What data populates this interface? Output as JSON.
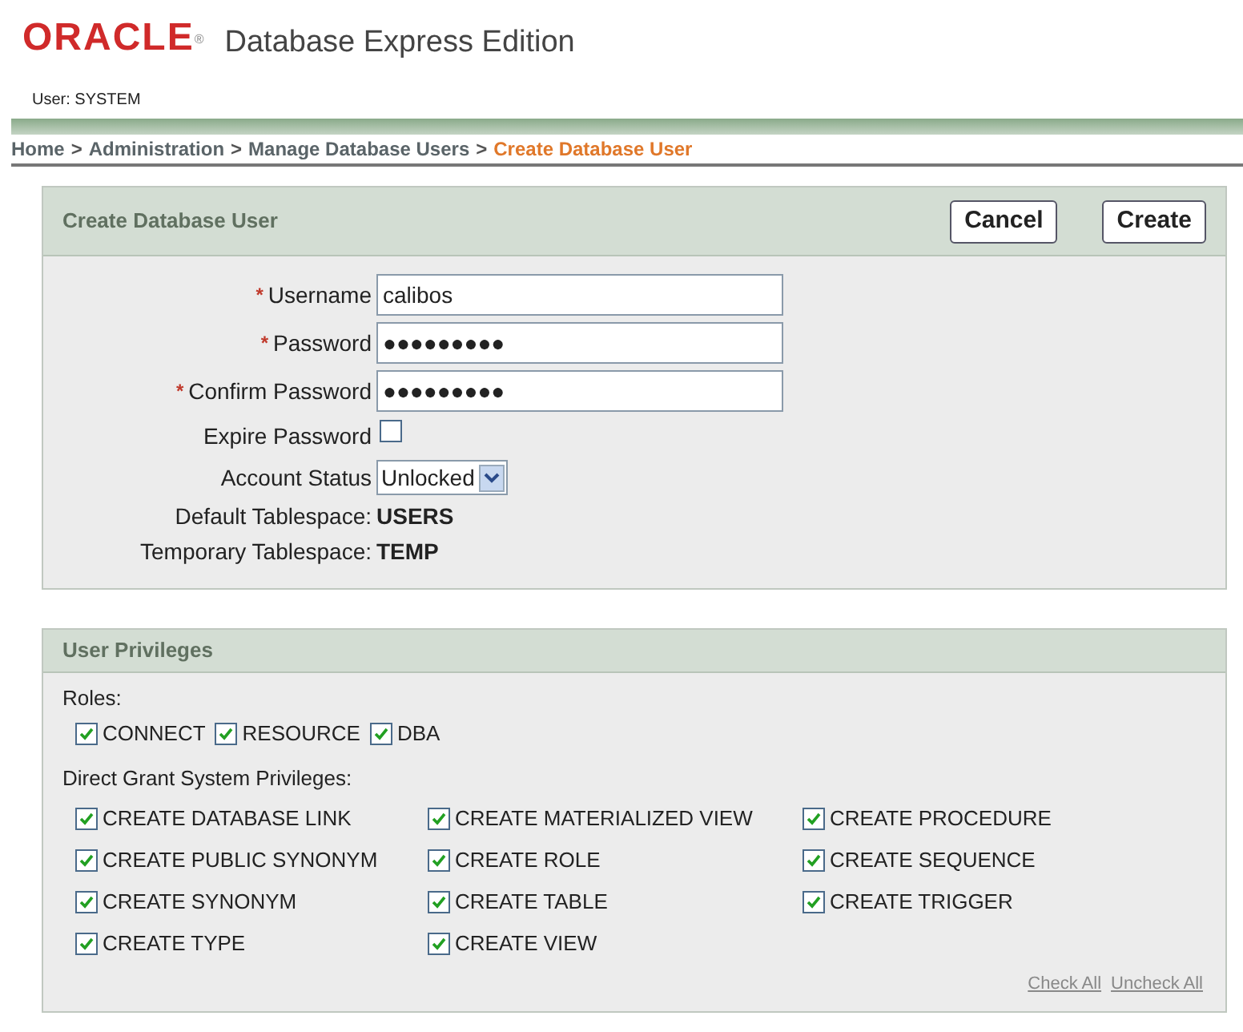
{
  "header": {
    "logo": "ORACLE",
    "logo_mark": "®",
    "product": "Database Express Edition",
    "user": "User: SYSTEM"
  },
  "breadcrumb": [
    {
      "label": "Home",
      "current": false
    },
    {
      "label": "Administration",
      "current": false
    },
    {
      "label": "Manage Database Users",
      "current": false
    },
    {
      "label": "Create Database User",
      "current": true
    }
  ],
  "breadcrumb_separator": ">",
  "create_panel": {
    "title": "Create Database User",
    "buttons": [
      "Cancel",
      "Create"
    ],
    "fields": [
      {
        "kind": "text",
        "label": "Username",
        "required": true,
        "value": "calibos"
      },
      {
        "kind": "text",
        "label": "Password",
        "required": true,
        "value": "●●●●●●●●●"
      },
      {
        "kind": "text",
        "label": "Confirm Password",
        "required": true,
        "value": "●●●●●●●●●"
      },
      {
        "kind": "checkbox",
        "label": "Expire Password",
        "required": false,
        "checked": false
      },
      {
        "kind": "select",
        "label": "Account Status",
        "required": false,
        "value": "Unlocked"
      },
      {
        "kind": "info",
        "label": "Default Tablespace:",
        "required": false,
        "value": "USERS"
      },
      {
        "kind": "info",
        "label": "Temporary Tablespace:",
        "required": false,
        "value": "TEMP"
      }
    ],
    "required_mark": "*"
  },
  "privileges_panel": {
    "title": "User Privileges",
    "roles_label": "Roles:",
    "roles": [
      {
        "label": "CONNECT",
        "checked": true
      },
      {
        "label": "RESOURCE",
        "checked": true
      },
      {
        "label": "DBA",
        "checked": true
      }
    ],
    "system_label": "Direct Grant System Privileges:",
    "system_privileges": [
      {
        "label": "CREATE DATABASE LINK",
        "checked": true
      },
      {
        "label": "CREATE MATERIALIZED VIEW",
        "checked": true
      },
      {
        "label": "CREATE PROCEDURE",
        "checked": true
      },
      {
        "label": "CREATE PUBLIC SYNONYM",
        "checked": true
      },
      {
        "label": "CREATE ROLE",
        "checked": true
      },
      {
        "label": "CREATE SEQUENCE",
        "checked": true
      },
      {
        "label": "CREATE SYNONYM",
        "checked": true
      },
      {
        "label": "CREATE TABLE",
        "checked": true
      },
      {
        "label": "CREATE TRIGGER",
        "checked": true
      },
      {
        "label": "CREATE TYPE",
        "checked": true
      },
      {
        "label": "CREATE VIEW",
        "checked": true
      }
    ],
    "links": [
      "Check All",
      "Uncheck All"
    ]
  }
}
